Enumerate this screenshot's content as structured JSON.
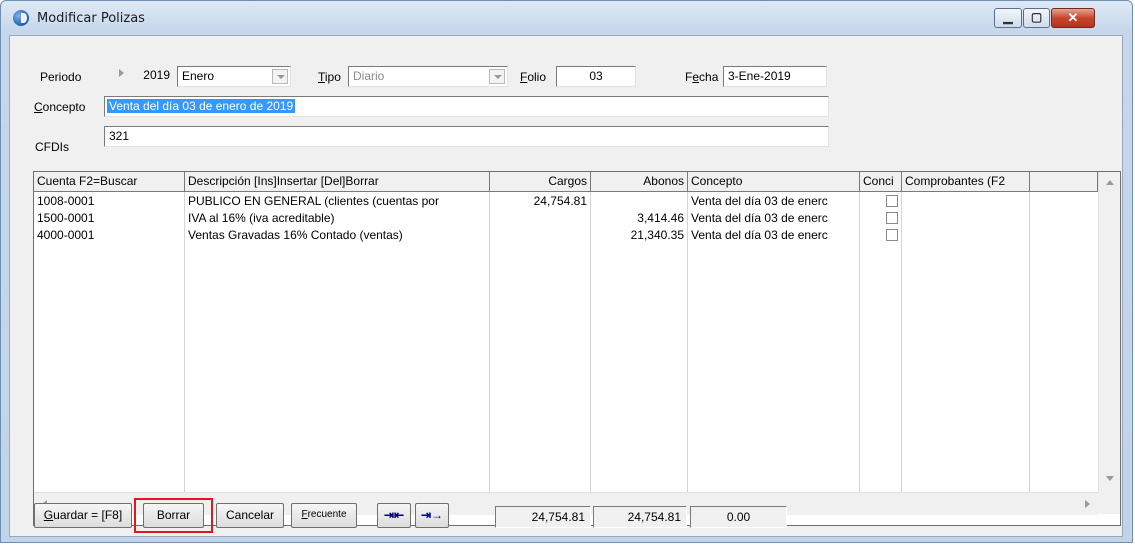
{
  "window": {
    "title": "Modificar Polizas",
    "controls": {
      "minimize_icon": "minimize-icon",
      "maximize_icon": "maximize-icon",
      "close_icon": "close-icon"
    }
  },
  "header": {
    "periodo_label": "Periodo",
    "periodo_year": "2019",
    "periodo_month": "Enero",
    "tipo_label": "Tipo",
    "tipo_value": "Diario",
    "folio_label": "Folio",
    "folio_value": "03",
    "fecha_label": "Fecha",
    "fecha_value": "3-Ene-2019",
    "concepto_label": "Concepto",
    "concepto_value": "Venta del día 03 de enero de 2019",
    "cfdis_label": "CFDIs",
    "cfdis_value": "321"
  },
  "grid": {
    "columns": [
      "Cuenta F2=Buscar",
      "Descripción  [Ins]Insertar  [Del]Borrar",
      "Cargos",
      "Abonos",
      "Concepto",
      "Conci",
      "Comprobantes (F2",
      ""
    ],
    "rows": [
      {
        "cuenta": "1008-0001",
        "descripcion": "PUBLICO EN GENERAL (clientes (cuentas por",
        "cargos": "24,754.81",
        "abonos": "",
        "concepto": "Venta del día 03 de enerc",
        "conci": false
      },
      {
        "cuenta": "1500-0001",
        "descripcion": "IVA al 16% (iva acreditable)",
        "cargos": "",
        "abonos": "3,414.46",
        "concepto": "Venta del día 03 de enerc",
        "conci": false
      },
      {
        "cuenta": "4000-0001",
        "descripcion": "Ventas Gravadas 16% Contado (ventas)",
        "cargos": "",
        "abonos": "21,340.35",
        "concepto": "Venta del día 03 de enerc",
        "conci": false
      }
    ]
  },
  "footer": {
    "guardar_label": "Guardar = [F8]",
    "borrar_label": "Borrar",
    "cancelar_label": "Cancelar",
    "frecuente_label": "Frecuente",
    "insert_row_icon": "insert-row-icon",
    "append_row_icon": "append-row-icon",
    "total_cargos": "24,754.81",
    "total_abonos": "24,754.81",
    "diferencia": "0.00",
    "highlight_color": "#e0191e"
  }
}
